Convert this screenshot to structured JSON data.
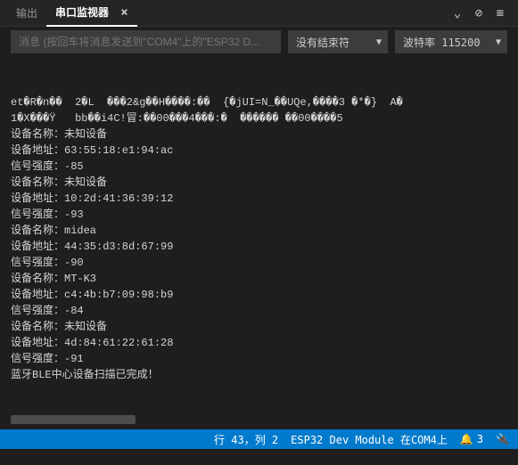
{
  "tabs": {
    "output": "输出",
    "serial_monitor": "串口监视器"
  },
  "toolbar": {
    "message_placeholder": "消息 (按回车将消息发送到\"COM4\"上的\"ESP32 D...",
    "line_ending": "没有结束符",
    "baud_rate": "波特率 115200"
  },
  "console_lines": [
    "et�R�n��  2�L  ���2&g��H����:��  {�jUI=N_��UQe,����3 �*�}  A�",
    "1�X���Ÿ   bb��i4C!冒:��00���4���:�  ������ ��00����5",
    "设备名称：未知设备",
    "设备地址：63:55:18:e1:94:ac",
    "信号强度：-85",
    "设备名称：未知设备",
    "设备地址：10:2d:41:36:39:12",
    "信号强度：-93",
    "设备名称：midea",
    "设备地址：44:35:d3:8d:67:99",
    "信号强度：-90",
    "设备名称：MT-K3",
    "设备地址：c4:4b:b7:09:98:b9",
    "信号强度：-84",
    "设备名称：未知设备",
    "设备地址：4d:84:61:22:61:28",
    "信号强度：-91",
    "蓝牙BLE中心设备扫描已完成！"
  ],
  "status": {
    "cursor": "行 43，列 2",
    "board": "ESP32 Dev Module 在COM4上",
    "notif_count": "3"
  }
}
